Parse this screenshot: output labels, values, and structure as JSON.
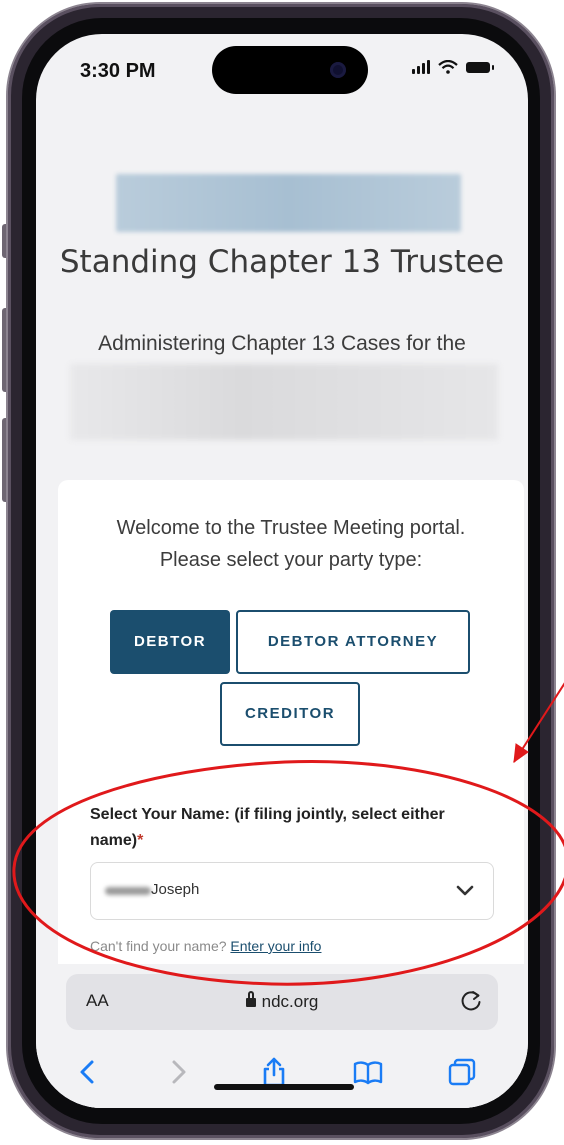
{
  "status_bar": {
    "time": "3:30 PM",
    "icons": [
      "signal-icon",
      "wifi-icon",
      "battery-icon"
    ]
  },
  "header": {
    "title": "Standing Chapter 13 Trustee",
    "subtitle": "Administering Chapter 13 Cases for the"
  },
  "portal": {
    "welcome_line1": "Welcome to the Trustee Meeting portal.",
    "welcome_line2": "Please select your party type:",
    "party_types": {
      "debtor": "DEBTOR",
      "debtor_attorney": "DEBTOR ATTORNEY",
      "creditor": "CREDITOR"
    },
    "selected_party": "DEBTOR",
    "name_field": {
      "label": "Select Your Name: (if filing jointly, select either name)",
      "required_mark": "*",
      "value": "Joseph"
    },
    "hint_text": "Can't find your name?",
    "hint_link": "Enter your info"
  },
  "browser": {
    "text_size_label": "AA",
    "url": "ndc.org",
    "toolbar_icons": [
      "back-icon",
      "forward-icon",
      "share-icon",
      "bookmarks-icon",
      "tabs-icon"
    ]
  },
  "colors": {
    "primary": "#1b4e6e",
    "annotation": "#e0191b",
    "page_bg": "#f2f2f4"
  }
}
